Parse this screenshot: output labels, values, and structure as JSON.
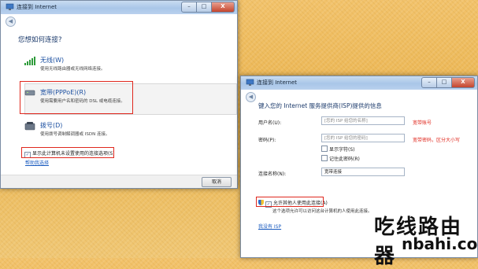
{
  "left_window": {
    "title": "连接到 Internet",
    "heading": "您想如何连接?",
    "options": [
      {
        "title": "无线(W)",
        "desc": "使用无线路由器或无线网络连接。"
      },
      {
        "title": "宽带(PPPoE)(R)",
        "desc": "使用需要用户名和密码的 DSL 或电缆连接。"
      },
      {
        "title": "拨号(D)",
        "desc": "使用拨号调制解调器或 ISDN 连接。"
      }
    ],
    "checkbox_label": "显示此计算机未设置使用的连接选项(S)",
    "help_link": "帮助我选择",
    "cancel_button": "取消",
    "ctrl_min": "–",
    "ctrl_max": "□",
    "ctrl_close": "X"
  },
  "right_window": {
    "title": "连接到 Internet",
    "heading": "键入您的 Internet 服务提供商(ISP)提供的信息",
    "username_label": "用户名(U):",
    "username_placeholder": "[您的 ISP 给您的名称]",
    "username_note": "宽带账号",
    "password_label": "密码(P):",
    "password_placeholder": "[您的 ISP 给您的密码]",
    "password_note": "宽带密码，区分大小写",
    "show_chars_label": "显示字符(S)",
    "remember_pw_label": "记住此密码(R)",
    "conn_name_label": "连接名称(N):",
    "conn_name_value": "宽带连接",
    "allow_others_label": "允许其他人使用此连接(A)",
    "allow_others_desc": "这个选项允许可以访问这台计算机的人使用此连接。",
    "no_isp_link": "我没有 ISP",
    "ctrl_min": "–",
    "ctrl_max": "□",
    "ctrl_close": "X"
  },
  "watermark": {
    "line1": "吃线路由器",
    "line2": "nbahi.com"
  }
}
